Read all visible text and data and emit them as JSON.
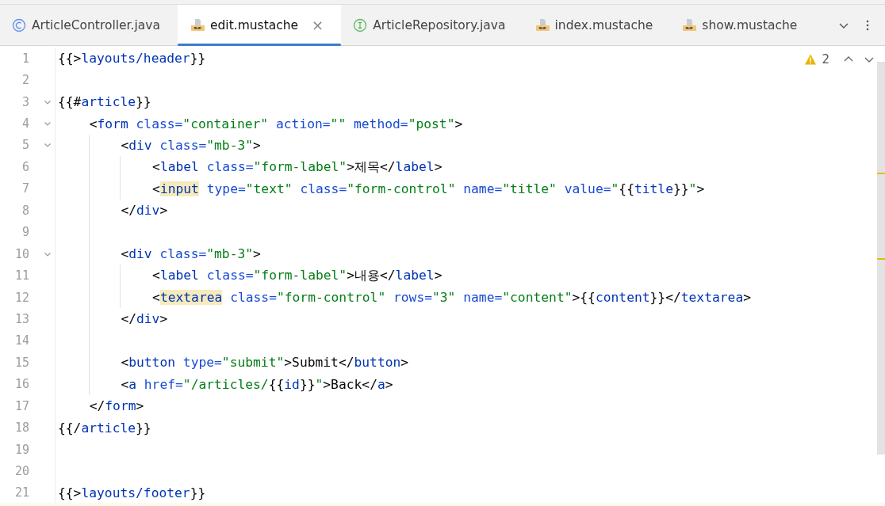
{
  "tabs": [
    {
      "label": "ArticleController.java",
      "kind": "class",
      "selected": false
    },
    {
      "label": "edit.mustache",
      "kind": "mustache",
      "selected": true,
      "close": "×"
    },
    {
      "label": "ArticleRepository.java",
      "kind": "interface",
      "selected": false
    },
    {
      "label": "index.mustache",
      "kind": "mustache",
      "selected": false
    },
    {
      "label": "show.mustache",
      "kind": "mustache",
      "selected": false
    }
  ],
  "inspections": {
    "warnings": "2"
  },
  "lines": [
    {
      "number": "1",
      "tokens": [
        {
          "text": "{{>",
          "kind": "punct"
        },
        {
          "text": "layouts/header",
          "kind": "var"
        },
        {
          "text": "}}",
          "kind": "punct"
        }
      ]
    },
    {
      "number": "2"
    },
    {
      "number": "3",
      "foldable": true,
      "tokens": [
        {
          "text": "{{#",
          "kind": "punct"
        },
        {
          "text": "article",
          "kind": "var"
        },
        {
          "text": "}}",
          "kind": "punct"
        }
      ],
      "children": [
        {
          "number": "4",
          "foldable": true,
          "tokens": [
            {
              "text": "<",
              "kind": "punct"
            },
            {
              "text": "form",
              "kind": "tag"
            },
            {
              "text": " class=",
              "kind": "attr"
            },
            {
              "text": "\"container\"",
              "kind": "str"
            },
            {
              "text": " action=",
              "kind": "attr"
            },
            {
              "text": "\"\"",
              "kind": "str"
            },
            {
              "text": " method=",
              "kind": "attr"
            },
            {
              "text": "\"post\"",
              "kind": "str"
            },
            {
              "text": ">",
              "kind": "punct"
            }
          ],
          "children": [
            {
              "number": "5",
              "foldable": true,
              "tokens": [
                {
                  "text": "<",
                  "kind": "punct"
                },
                {
                  "text": "div",
                  "kind": "tag"
                },
                {
                  "text": " class=",
                  "kind": "attr"
                },
                {
                  "text": "\"mb-3\"",
                  "kind": "str"
                },
                {
                  "text": ">",
                  "kind": "punct"
                }
              ],
              "children": [
                {
                  "number": "6",
                  "tokens": [
                    {
                      "text": "<",
                      "kind": "punct"
                    },
                    {
                      "text": "label",
                      "kind": "tag"
                    },
                    {
                      "text": " class=",
                      "kind": "attr"
                    },
                    {
                      "text": "\"form-label\"",
                      "kind": "str"
                    },
                    {
                      "text": ">제목</",
                      "kind": "punct"
                    },
                    {
                      "text": "label",
                      "kind": "tag"
                    },
                    {
                      "text": ">",
                      "kind": "punct"
                    }
                  ]
                },
                {
                  "number": "7",
                  "tokens": [
                    {
                      "text": "<",
                      "kind": "punct"
                    },
                    {
                      "text": "input",
                      "kind": "match"
                    },
                    {
                      "text": " type=",
                      "kind": "attr"
                    },
                    {
                      "text": "\"text\"",
                      "kind": "str"
                    },
                    {
                      "text": " class=",
                      "kind": "attr"
                    },
                    {
                      "text": "\"form-control\"",
                      "kind": "str"
                    },
                    {
                      "text": " name=",
                      "kind": "attr"
                    },
                    {
                      "text": "\"title\"",
                      "kind": "str"
                    },
                    {
                      "text": " value=",
                      "kind": "attr"
                    },
                    {
                      "text": "\"",
                      "kind": "str"
                    },
                    {
                      "text": "{{",
                      "kind": "punct"
                    },
                    {
                      "text": "title",
                      "kind": "var"
                    },
                    {
                      "text": "}}",
                      "kind": "punct"
                    },
                    {
                      "text": "\"",
                      "kind": "str"
                    },
                    {
                      "text": ">",
                      "kind": "punct"
                    }
                  ]
                }
              ]
            },
            {
              "number": "8",
              "tokens": [
                {
                  "text": "</",
                  "kind": "punct"
                },
                {
                  "text": "div",
                  "kind": "tag"
                },
                {
                  "text": ">",
                  "kind": "punct"
                }
              ]
            },
            {
              "number": "9"
            },
            {
              "number": "10",
              "foldable": true,
              "tokens": [
                {
                  "text": "<",
                  "kind": "punct"
                },
                {
                  "text": "div",
                  "kind": "tag"
                },
                {
                  "text": " class=",
                  "kind": "attr"
                },
                {
                  "text": "\"mb-3\"",
                  "kind": "str"
                },
                {
                  "text": ">",
                  "kind": "punct"
                }
              ],
              "children": [
                {
                  "number": "11",
                  "tokens": [
                    {
                      "text": "<",
                      "kind": "punct"
                    },
                    {
                      "text": "label",
                      "kind": "tag"
                    },
                    {
                      "text": " class=",
                      "kind": "attr"
                    },
                    {
                      "text": "\"form-label\"",
                      "kind": "str"
                    },
                    {
                      "text": ">내용</",
                      "kind": "punct"
                    },
                    {
                      "text": "label",
                      "kind": "tag"
                    },
                    {
                      "text": ">",
                      "kind": "punct"
                    }
                  ]
                },
                {
                  "number": "12",
                  "tokens": [
                    {
                      "text": "<",
                      "kind": "punct"
                    },
                    {
                      "text": "textarea",
                      "kind": "match"
                    },
                    {
                      "text": " class=",
                      "kind": "attr"
                    },
                    {
                      "text": "\"form-control\"",
                      "kind": "str"
                    },
                    {
                      "text": " rows=",
                      "kind": "attr"
                    },
                    {
                      "text": "\"3\"",
                      "kind": "str"
                    },
                    {
                      "text": " name=",
                      "kind": "attr"
                    },
                    {
                      "text": "\"content\"",
                      "kind": "str"
                    },
                    {
                      "text": ">{{",
                      "kind": "punct"
                    },
                    {
                      "text": "content",
                      "kind": "var"
                    },
                    {
                      "text": "}}</",
                      "kind": "punct"
                    },
                    {
                      "text": "textarea",
                      "kind": "tag"
                    },
                    {
                      "text": ">",
                      "kind": "punct"
                    }
                  ]
                }
              ]
            },
            {
              "number": "13",
              "tokens": [
                {
                  "text": "</",
                  "kind": "punct"
                },
                {
                  "text": "div",
                  "kind": "tag"
                },
                {
                  "text": ">",
                  "kind": "punct"
                }
              ]
            },
            {
              "number": "14"
            },
            {
              "number": "15",
              "tokens": [
                {
                  "text": "<",
                  "kind": "punct"
                },
                {
                  "text": "button",
                  "kind": "tag"
                },
                {
                  "text": " type=",
                  "kind": "attr"
                },
                {
                  "text": "\"submit\"",
                  "kind": "str"
                },
                {
                  "text": ">Submit</",
                  "kind": "punct"
                },
                {
                  "text": "button",
                  "kind": "tag"
                },
                {
                  "text": ">",
                  "kind": "punct"
                }
              ]
            },
            {
              "number": "16",
              "tokens": [
                {
                  "text": "<",
                  "kind": "punct"
                },
                {
                  "text": "a",
                  "kind": "tag"
                },
                {
                  "text": " href=",
                  "kind": "attr"
                },
                {
                  "text": "\"/articles/",
                  "kind": "str"
                },
                {
                  "text": "{{",
                  "kind": "punct"
                },
                {
                  "text": "id",
                  "kind": "var"
                },
                {
                  "text": "}}",
                  "kind": "punct"
                },
                {
                  "text": "\"",
                  "kind": "str"
                },
                {
                  "text": ">Back</",
                  "kind": "punct"
                },
                {
                  "text": "a",
                  "kind": "tag"
                },
                {
                  "text": ">",
                  "kind": "punct"
                }
              ]
            }
          ]
        },
        {
          "number": "17",
          "tokens": [
            {
              "text": "</",
              "kind": "punct"
            },
            {
              "text": "form",
              "kind": "tag"
            },
            {
              "text": ">",
              "kind": "punct"
            }
          ]
        }
      ]
    },
    {
      "number": "18",
      "tokens": [
        {
          "text": "{{/",
          "kind": "punct"
        },
        {
          "text": "article",
          "kind": "var"
        },
        {
          "text": "}}",
          "kind": "punct"
        }
      ]
    },
    {
      "number": "19"
    },
    {
      "number": "20"
    },
    {
      "number": "21",
      "tokens": [
        {
          "text": "{{>",
          "kind": "punct"
        },
        {
          "text": "layouts/footer",
          "kind": "var"
        },
        {
          "text": "}}",
          "kind": "punct"
        }
      ]
    }
  ]
}
